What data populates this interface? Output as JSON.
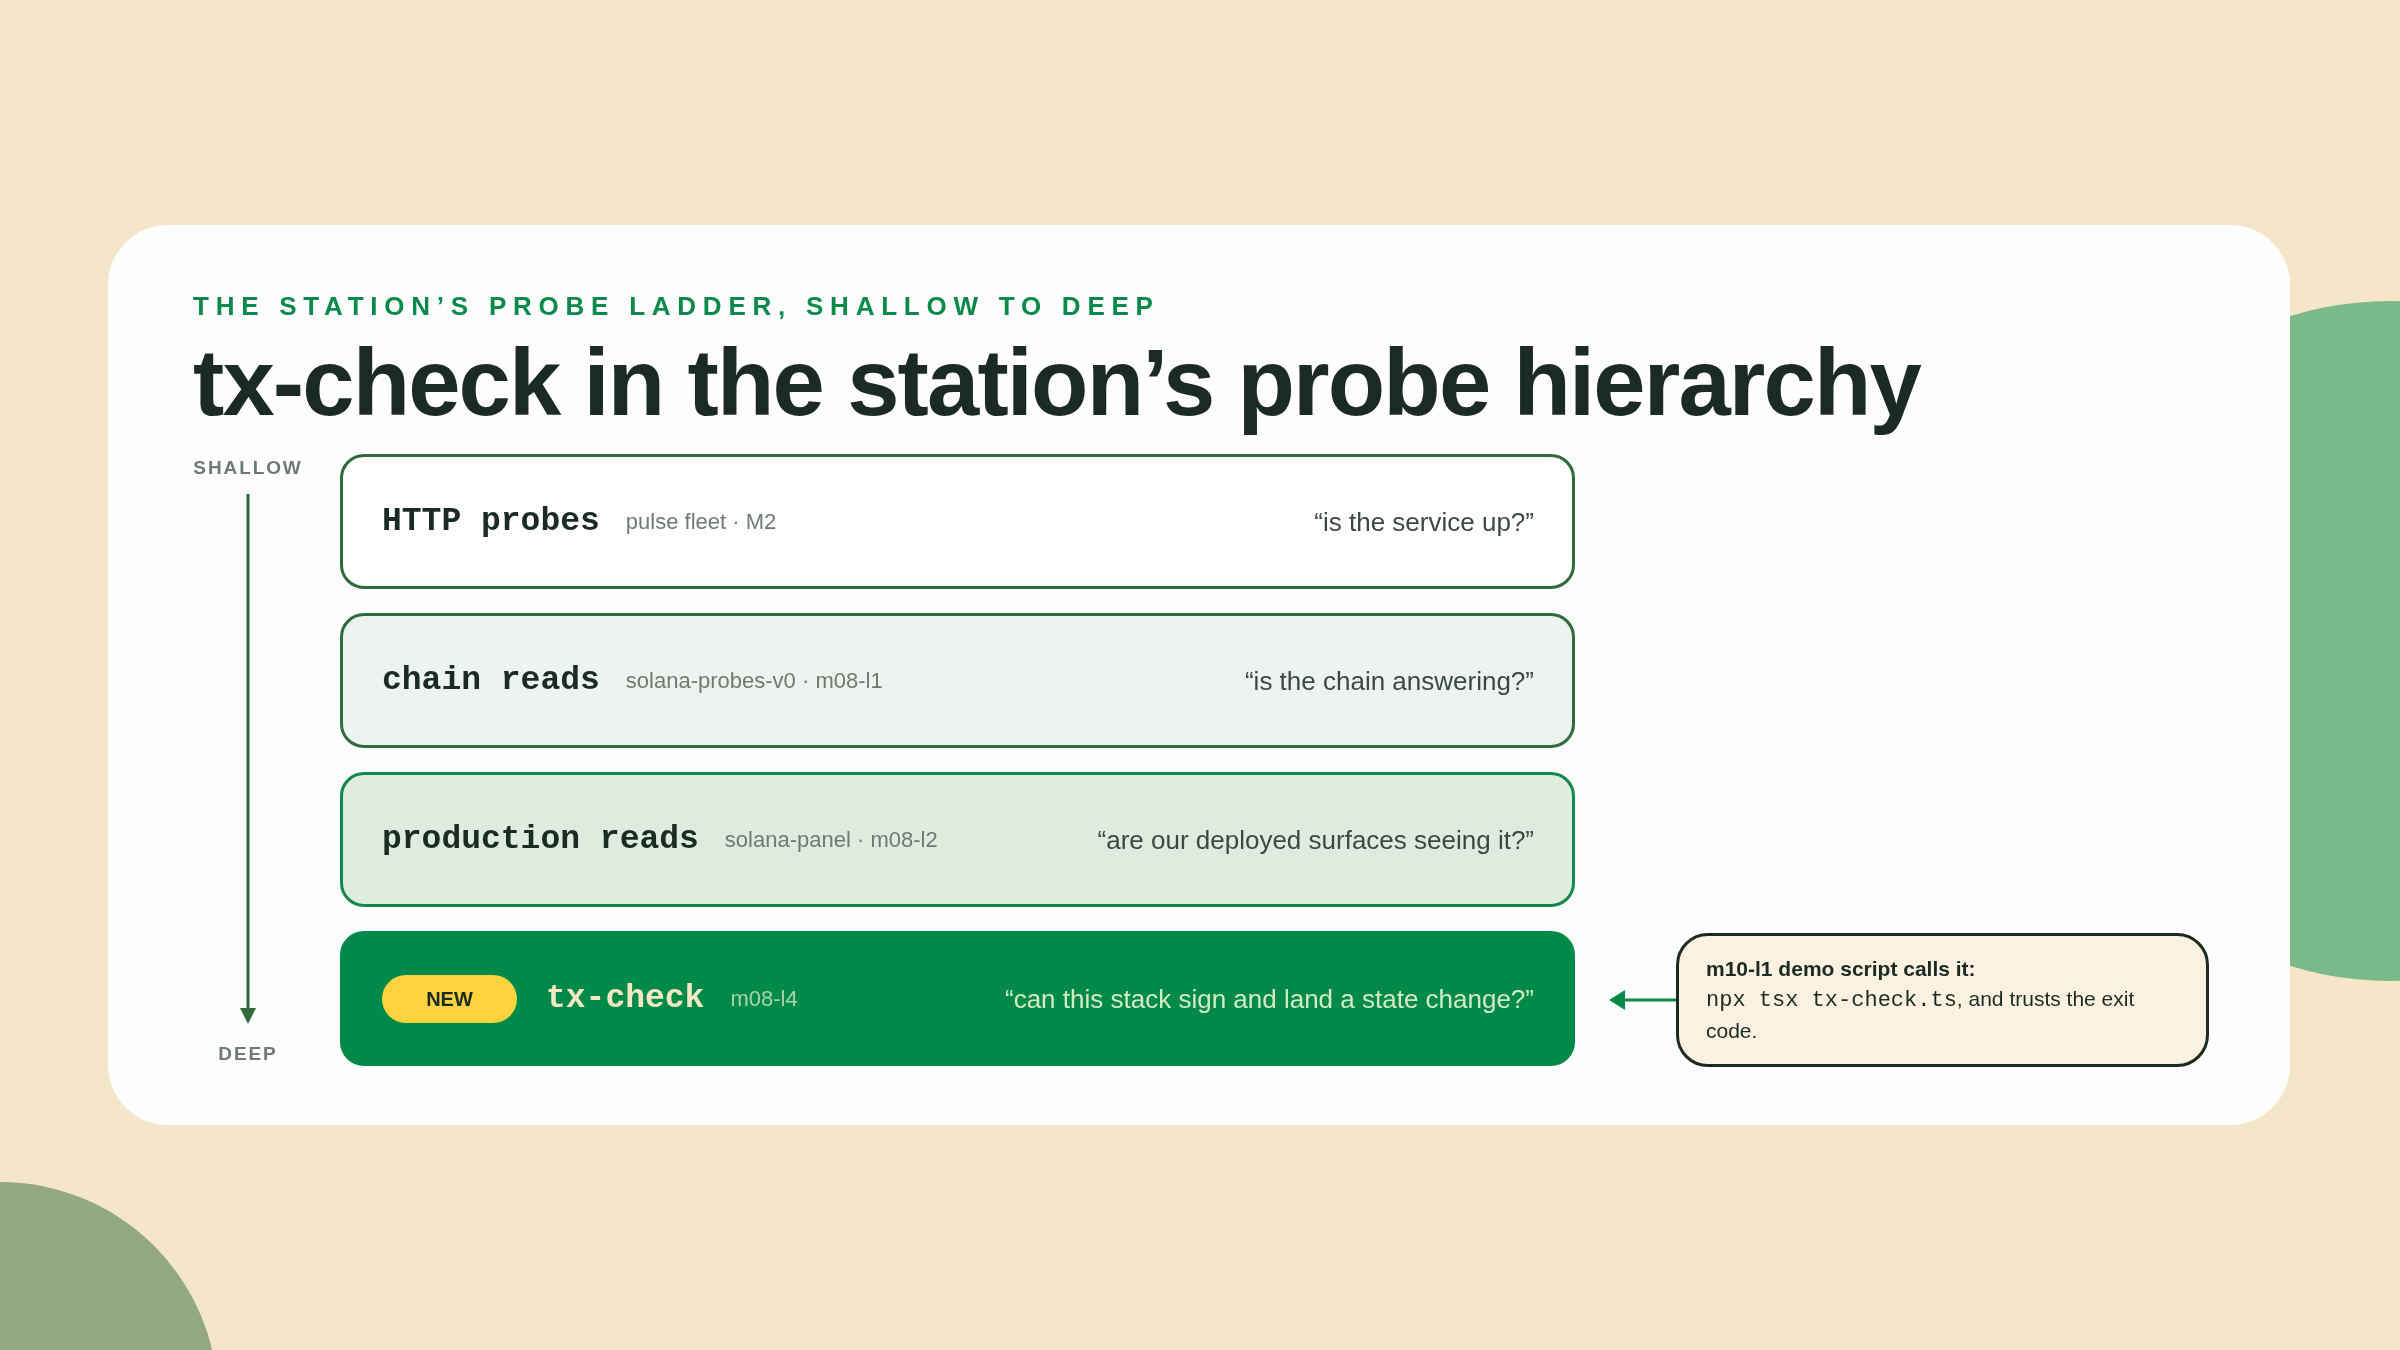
{
  "eyebrow": "THE STATION’S PROBE LADDER, SHALLOW TO DEEP",
  "title": "tx-check in the station’s probe hierarchy",
  "axis": {
    "top_label": "SHALLOW",
    "bottom_label": "DEEP"
  },
  "probes": [
    {
      "kind": "plain",
      "name": "HTTP probes",
      "source": "pulse fleet · M2",
      "question": "“is the service up?”"
    },
    {
      "kind": "light",
      "name": "chain reads",
      "source": "solana-probes-v0 · m08-l1",
      "question": "“is the chain answering?”"
    },
    {
      "kind": "medium",
      "name": "production reads",
      "source": "solana-panel · m08-l2",
      "question": "“are our deployed surfaces seeing it?”"
    },
    {
      "kind": "featured",
      "badge": "NEW",
      "name": "tx-check",
      "source": "m08-l4",
      "question": "“can this stack sign and land a state change?”"
    }
  ],
  "callout": {
    "title": "m10-l1 demo script calls it:",
    "code": "npx tsx tx-check.ts",
    "text": ", and trusts the exit code."
  }
}
